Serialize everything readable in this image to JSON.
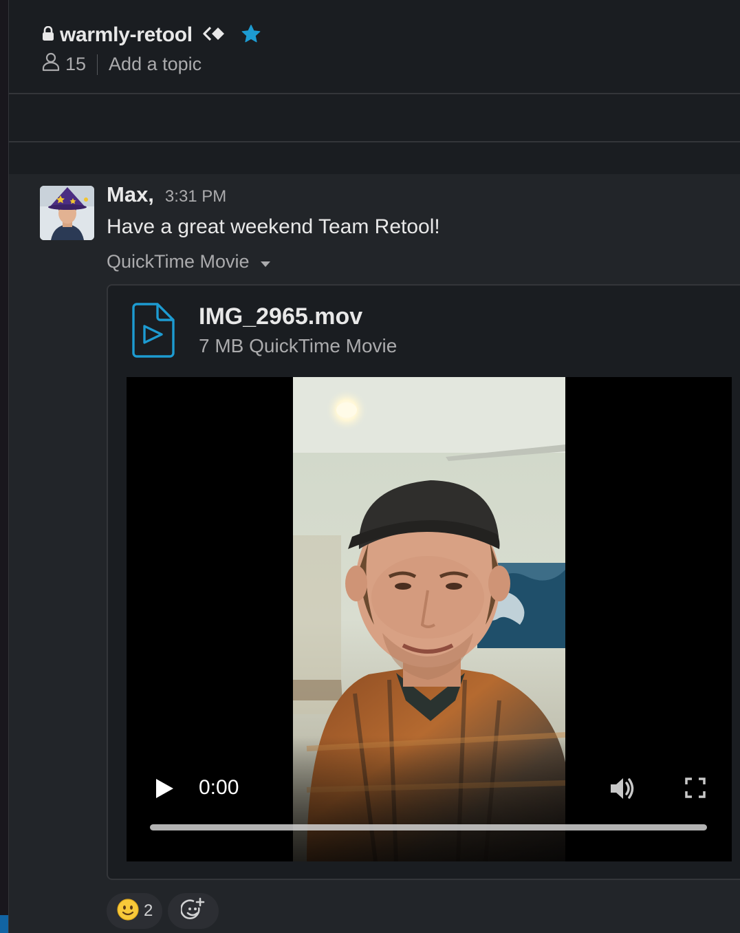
{
  "channel": {
    "name": "warmly-retool",
    "private": true,
    "shared": true,
    "starred": true,
    "member_count": "15",
    "topic_placeholder": "Add a topic"
  },
  "message": {
    "sender": "Max,",
    "timestamp": "3:31 PM",
    "text": "Have a great weekend Team Retool!",
    "attachment_toggle_label": "QuickTime Movie",
    "file": {
      "name": "IMG_2965.mov",
      "meta": "7 MB QuickTime Movie"
    },
    "video": {
      "current_time": "0:00",
      "progress": 0
    },
    "reactions": [
      {
        "emoji": "slightly-smiling-face",
        "count": "2"
      }
    ]
  },
  "colors": {
    "background": "#1a1d21",
    "message_background": "#222529",
    "star": "#1d9bd1",
    "file_icon": "#1d9bd1",
    "accent_rail": "#1164a3"
  }
}
